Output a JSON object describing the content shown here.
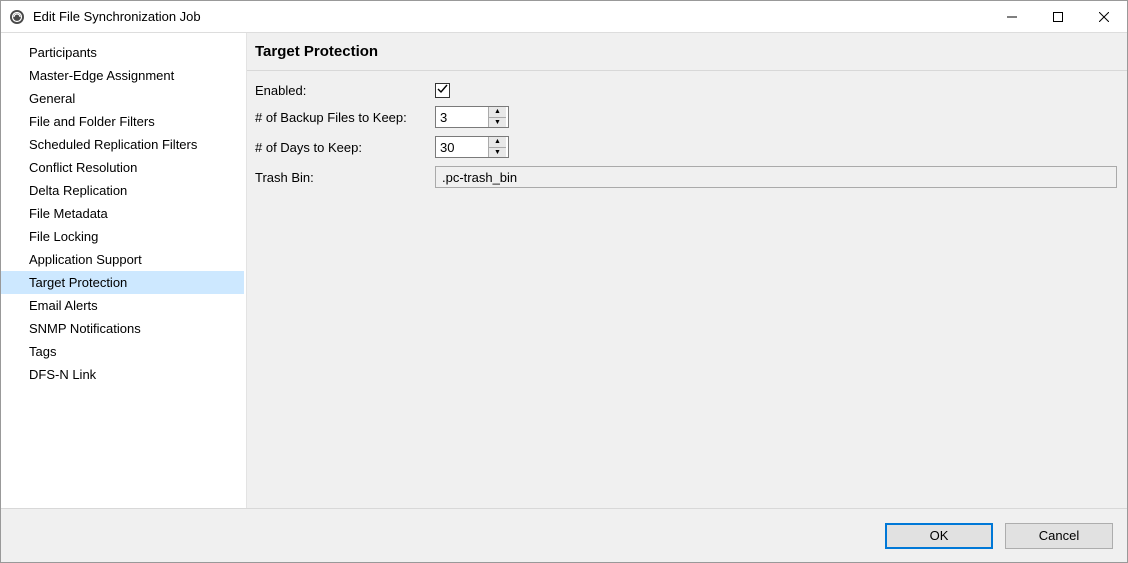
{
  "window": {
    "title": "Edit File Synchronization Job"
  },
  "sidebar": {
    "items": [
      {
        "label": "Participants",
        "selected": false
      },
      {
        "label": "Master-Edge Assignment",
        "selected": false
      },
      {
        "label": "General",
        "selected": false
      },
      {
        "label": "File and Folder Filters",
        "selected": false
      },
      {
        "label": "Scheduled Replication Filters",
        "selected": false
      },
      {
        "label": "Conflict Resolution",
        "selected": false
      },
      {
        "label": "Delta Replication",
        "selected": false
      },
      {
        "label": "File Metadata",
        "selected": false
      },
      {
        "label": "File Locking",
        "selected": false
      },
      {
        "label": "Application Support",
        "selected": false
      },
      {
        "label": "Target Protection",
        "selected": true
      },
      {
        "label": "Email Alerts",
        "selected": false
      },
      {
        "label": "SNMP Notifications",
        "selected": false
      },
      {
        "label": "Tags",
        "selected": false
      },
      {
        "label": "DFS-N Link",
        "selected": false
      }
    ]
  },
  "content": {
    "title": "Target Protection",
    "fields": {
      "enabled_label": "Enabled:",
      "enabled_value": true,
      "backup_files_label": "# of Backup Files to Keep:",
      "backup_files_value": "3",
      "days_label": "# of Days to Keep:",
      "days_value": "30",
      "trashbin_label": "Trash Bin:",
      "trashbin_value": ".pc-trash_bin"
    }
  },
  "footer": {
    "ok_label": "OK",
    "cancel_label": "Cancel"
  }
}
